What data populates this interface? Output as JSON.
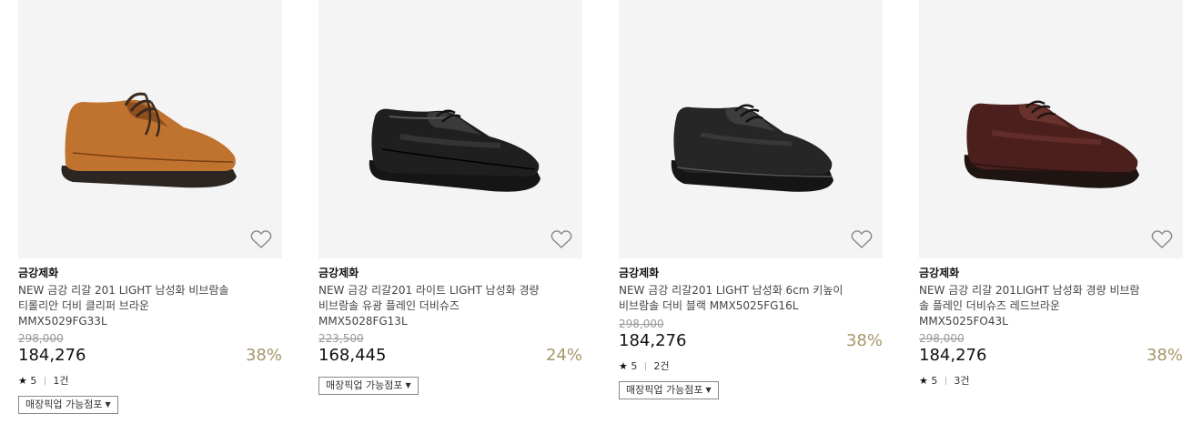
{
  "products": [
    {
      "brand": "금강제화",
      "name_line1": "NEW 금강 리갈 201 LIGHT 남성화 비브람솔",
      "name_line2": "티롤리안 더비 클리퍼 브라운",
      "code": "MMX5029FG33L",
      "original_price": "298,000",
      "sale_price": "184,276",
      "discount": "38%",
      "rating": "5",
      "review_count": "1건",
      "pickup_label": "매장픽업 가능점포",
      "shoe_color": "#c0722f",
      "wish_icon": "heart-outline-icon"
    },
    {
      "brand": "금강제화",
      "name_line1": "NEW 금강 리갈201 라이트 LIGHT 남성화 경량",
      "name_line2": "비브람솔 유광 플레인 더비슈즈",
      "code": "MMX5028FG13L",
      "original_price": "223,500",
      "sale_price": "168,445",
      "discount": "24%",
      "rating": "",
      "review_count": "",
      "pickup_label": "매장픽업 가능점포",
      "shoe_color": "#1f1f1f",
      "wish_icon": "heart-outline-icon"
    },
    {
      "brand": "금강제화",
      "name_line1": "NEW 금강 리갈201 LIGHT 남성화 6cm 키높이",
      "name_line2": "비브람솔 더비 블랙 MMX5025FG16L",
      "code": "",
      "original_price": "298,000",
      "sale_price": "184,276",
      "discount": "38%",
      "rating": "5",
      "review_count": "2건",
      "pickup_label": "매장픽업 가능점포",
      "shoe_color": "#262626",
      "wish_icon": "heart-outline-icon"
    },
    {
      "brand": "금강제화",
      "name_line1": "NEW 금강 리갈 201LIGHT 남성화 경량 비브람",
      "name_line2": "솔 플레인 더비슈즈 레드브라운",
      "code": "MMX5025FO43L",
      "original_price": "298,000",
      "sale_price": "184,276",
      "discount": "38%",
      "rating": "5",
      "review_count": "3건",
      "pickup_label": "",
      "shoe_color": "#4a1f1c",
      "wish_icon": "heart-outline-icon"
    }
  ],
  "colors": {
    "discount": "#a59769",
    "image_bg": "#f4f4f4",
    "sole": "#2b2622"
  },
  "icons": {
    "star": "★",
    "caret": "▼"
  }
}
